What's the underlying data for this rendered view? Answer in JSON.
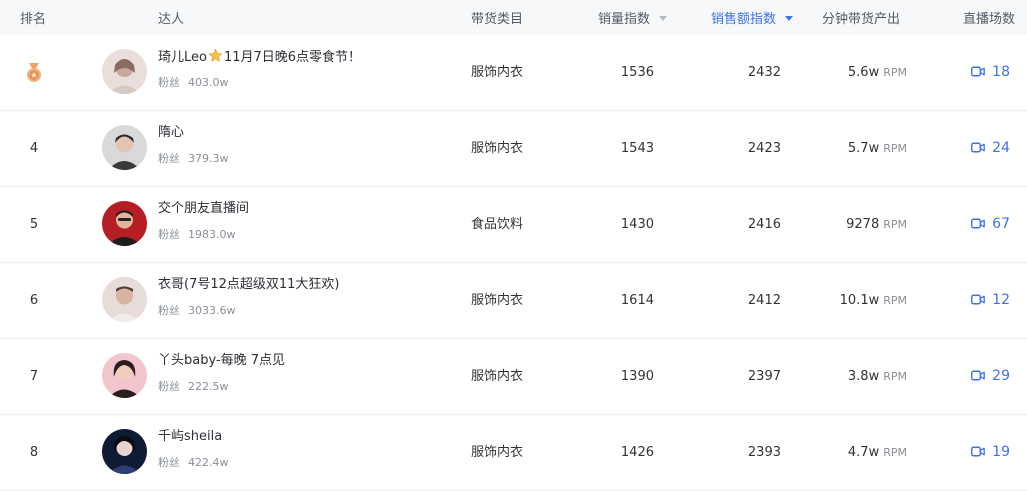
{
  "header": {
    "rank": "排名",
    "streamer": "达人",
    "category": "带货类目",
    "sales_index": "销量指数",
    "sales_amount_index": "销售额指数",
    "rpm_output": "分钟带货产出",
    "live_sessions": "直播场数"
  },
  "colors": {
    "accent": "#3d73e6",
    "medal": "#e8a46a"
  },
  "fans_label": "粉丝",
  "rpm_unit": "RPM",
  "rows": [
    {
      "rank": "",
      "rank_icon": "bronze-medal-icon",
      "name_before": "琦儿Leo",
      "name_icon": "star-icon",
      "name_after": "11月7日晚6点零食节！",
      "fans": "403.0w",
      "category": "服饰内衣",
      "sales_index": "1536",
      "sales_amount_index": "2432",
      "rpm": "5.6w",
      "live_sessions": "18"
    },
    {
      "rank": "4",
      "name_before": "隋心",
      "name_after": "",
      "fans": "379.3w",
      "category": "服饰内衣",
      "sales_index": "1543",
      "sales_amount_index": "2423",
      "rpm": "5.7w",
      "live_sessions": "24"
    },
    {
      "rank": "5",
      "name_before": "交个朋友直播间",
      "name_after": "",
      "fans": "1983.0w",
      "category": "食品饮料",
      "sales_index": "1430",
      "sales_amount_index": "2416",
      "rpm": "9278",
      "live_sessions": "67"
    },
    {
      "rank": "6",
      "name_before": "衣哥(7号12点超级双11大狂欢)",
      "name_after": "",
      "fans": "3033.6w",
      "category": "服饰内衣",
      "sales_index": "1614",
      "sales_amount_index": "2412",
      "rpm": "10.1w",
      "live_sessions": "12"
    },
    {
      "rank": "7",
      "name_before": "丫头baby-每晚 7点见",
      "name_after": "",
      "fans": "222.5w",
      "category": "服饰内衣",
      "sales_index": "1390",
      "sales_amount_index": "2397",
      "rpm": "3.8w",
      "live_sessions": "29"
    },
    {
      "rank": "8",
      "name_before": "千屿sheila",
      "name_after": "",
      "fans": "422.4w",
      "category": "服饰内衣",
      "sales_index": "1426",
      "sales_amount_index": "2393",
      "rpm": "4.7w",
      "live_sessions": "19"
    }
  ]
}
